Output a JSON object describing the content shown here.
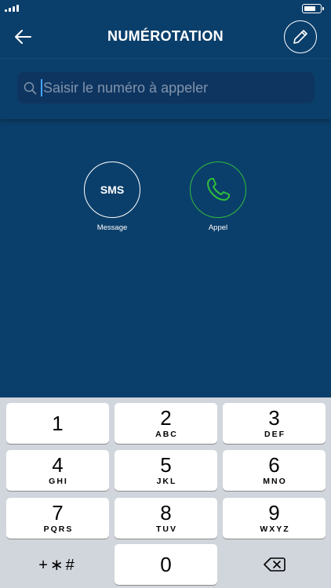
{
  "navbar": {
    "title": "NUMÉROTATION",
    "back_icon": "arrow-left-icon",
    "edit_icon": "pencil-icon"
  },
  "search": {
    "placeholder": "Saisir le numéro à appeler",
    "value": "",
    "icon": "search-icon"
  },
  "actions": {
    "sms_circle_text": "SMS",
    "sms_label": "Message",
    "call_label": "Appel",
    "call_icon": "phone-icon",
    "call_color": "#2fbe3c"
  },
  "keypad": {
    "keys": [
      {
        "num": "1",
        "letters": ""
      },
      {
        "num": "2",
        "letters": "ABC"
      },
      {
        "num": "3",
        "letters": "DEF"
      },
      {
        "num": "4",
        "letters": "GHI"
      },
      {
        "num": "5",
        "letters": "JKL"
      },
      {
        "num": "6",
        "letters": "MNO"
      },
      {
        "num": "7",
        "letters": "PQRS"
      },
      {
        "num": "8",
        "letters": "TUV"
      },
      {
        "num": "9",
        "letters": "WXYZ"
      },
      {
        "num": "0",
        "letters": ""
      }
    ],
    "symbols_label": "+∗#",
    "delete_icon": "backspace-icon"
  },
  "colors": {
    "background": "#0b3f6b",
    "keypad_bg": "#d1d5dc",
    "caret": "#4aa3ff"
  }
}
